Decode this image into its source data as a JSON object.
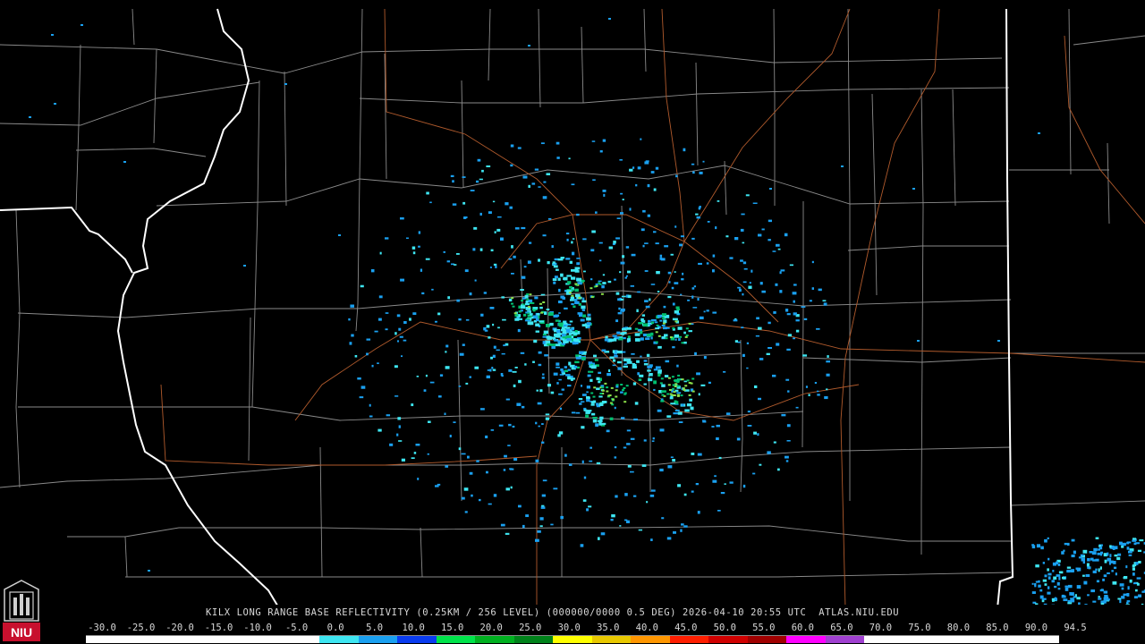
{
  "product": {
    "title": "KILX LONG RANGE BASE REFLECTIVITY (0.25KM / 256 LEVEL) (000000/0000 0.5 DEG) 2026-04-10 20:55 UTC  ATLAS.NIU.EDU"
  },
  "logo": {
    "label": "NIU",
    "brand_color": "#c8102e"
  },
  "colorbar": {
    "tick_labels": [
      "-30.0",
      "-25.0",
      "-20.0",
      "-15.0",
      "-10.0",
      "-5.0",
      "0.0",
      "5.0",
      "10.0",
      "15.0",
      "20.0",
      "25.0",
      "30.0",
      "35.0",
      "40.0",
      "45.0",
      "50.0",
      "55.0",
      "60.0",
      "65.0",
      "70.0",
      "75.0",
      "80.0",
      "85.0",
      "90.0",
      "94.5"
    ],
    "segment_colors": [
      "#ffffff",
      "#ffffff",
      "#ffffff",
      "#ffffff",
      "#ffffff",
      "#ffffff",
      "#3ee6f2",
      "#1aa0f0",
      "#0a3cf0",
      "#00e34a",
      "#00b020",
      "#00821a",
      "#ffff00",
      "#e8c800",
      "#ff9600",
      "#ff1e00",
      "#d00000",
      "#a00000",
      "#ff00ff",
      "#a040d0",
      "#ffffff",
      "#ffffff",
      "#ffffff",
      "#ffffff",
      "#ffffff"
    ]
  },
  "map": {
    "background": "#000000",
    "county_line_color": "#8a8a8a",
    "state_line_color": "#ffffff",
    "highway_color": "#b05a2c",
    "echo_colors": [
      "#1aa0f0",
      "#3ee6f2",
      "#00c070",
      "#8ce04a"
    ]
  }
}
